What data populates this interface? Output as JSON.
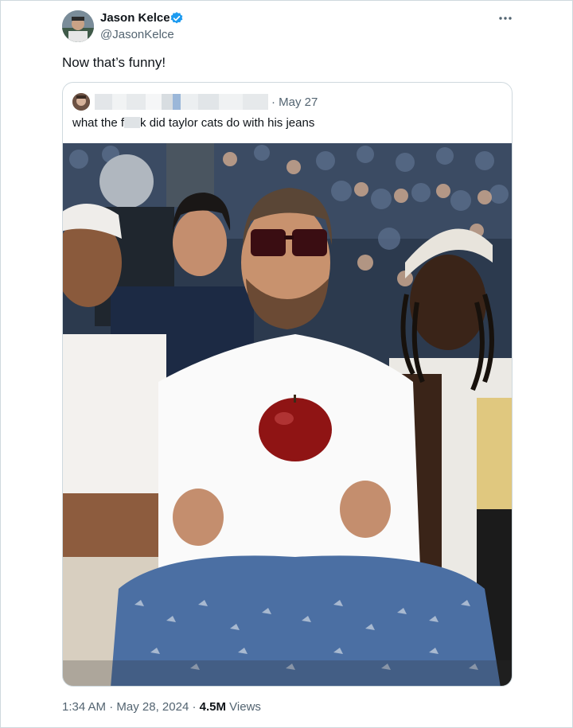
{
  "author": {
    "name": "Jason Kelce",
    "handle": "@JasonKelce",
    "verified_color": "#1d9bf0"
  },
  "tweet": {
    "text": "Now that’s funny!"
  },
  "quote": {
    "date": "· May 27",
    "text_before": "what the f",
    "text_after": "k did taylor cats do with his jeans"
  },
  "meta": {
    "time": "1:34 AM",
    "separator1": "·",
    "date": "May 28, 2024",
    "separator2": "·",
    "views_count": "4.5M",
    "views_label": "Views"
  },
  "icons": {
    "more": "more-horizontal-icon",
    "verified": "verified-badge-icon"
  }
}
